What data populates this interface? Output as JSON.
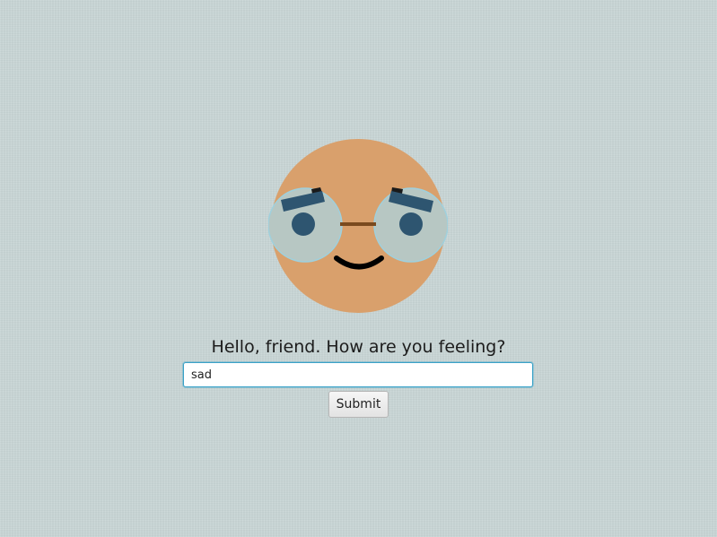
{
  "face": {
    "skin_color": "#d9a06c",
    "lens_color": "#b7c7c3",
    "lens_rim_color": "#9fd0dd",
    "pupil_color": "#2e5570",
    "brow_color": "#2e5570",
    "bridge_color": "#7a4a1e",
    "mouth_color": "#000000"
  },
  "prompt": {
    "greeting": "Hello, friend. How are you feeling?",
    "input_value": "sad",
    "submit_label": "Submit"
  }
}
